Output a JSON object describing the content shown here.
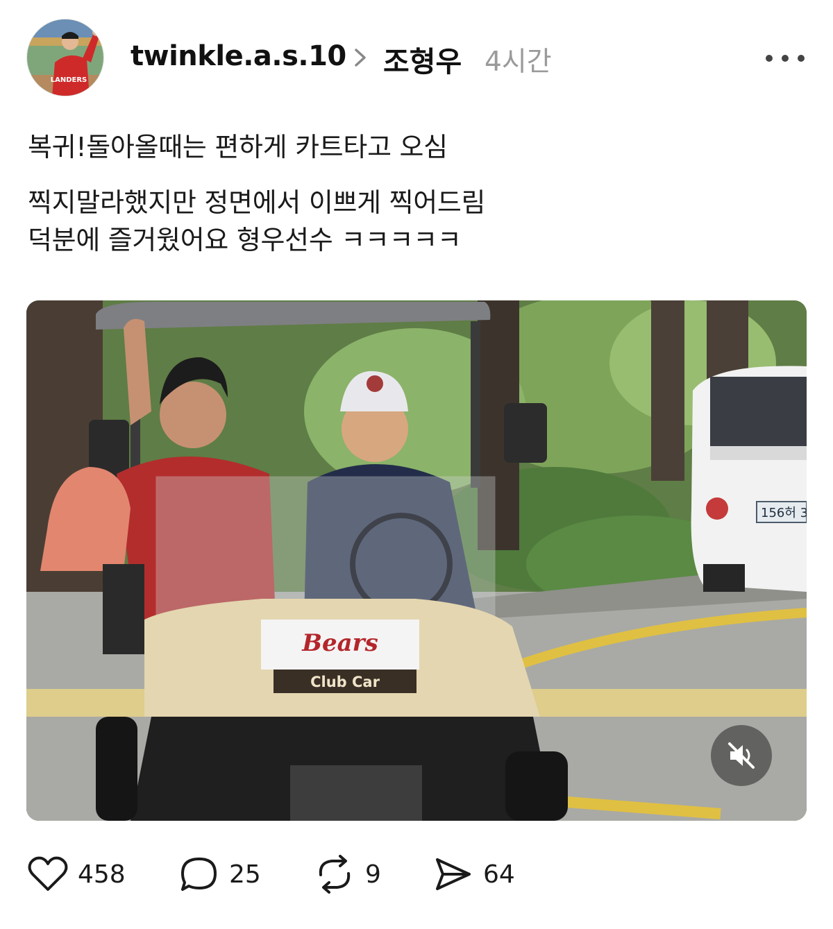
{
  "post": {
    "author": "twinkle.a.s.10",
    "reply_to": "조형우",
    "time_ago": "4시간",
    "paragraph1": "복귀!돌아올때는 편하게 카트타고 오심",
    "paragraph2_line1": "찍지말라했지만 정면에서 이쁘게 찍어드림",
    "paragraph2_line2": "덕분에 즐거웠어요 형우선수 ㅋㅋㅋㅋㅋ"
  },
  "media": {
    "cart_logo": "Bears",
    "cart_plate": "Club Car",
    "car_plate": "156허 3",
    "avatar_jersey": "LANDERS"
  },
  "actions": {
    "likes": "458",
    "comments": "25",
    "reposts": "9",
    "shares": "64"
  },
  "icons": {
    "more": "more-dots-icon",
    "chevron": "chevron-right-icon",
    "mute": "speaker-muted-icon",
    "like": "heart-icon",
    "comment": "comment-bubble-icon",
    "repost": "repost-icon",
    "share": "send-icon"
  },
  "colors": {
    "text": "#111111",
    "muted": "#9a9a9a",
    "background": "#ffffff"
  }
}
